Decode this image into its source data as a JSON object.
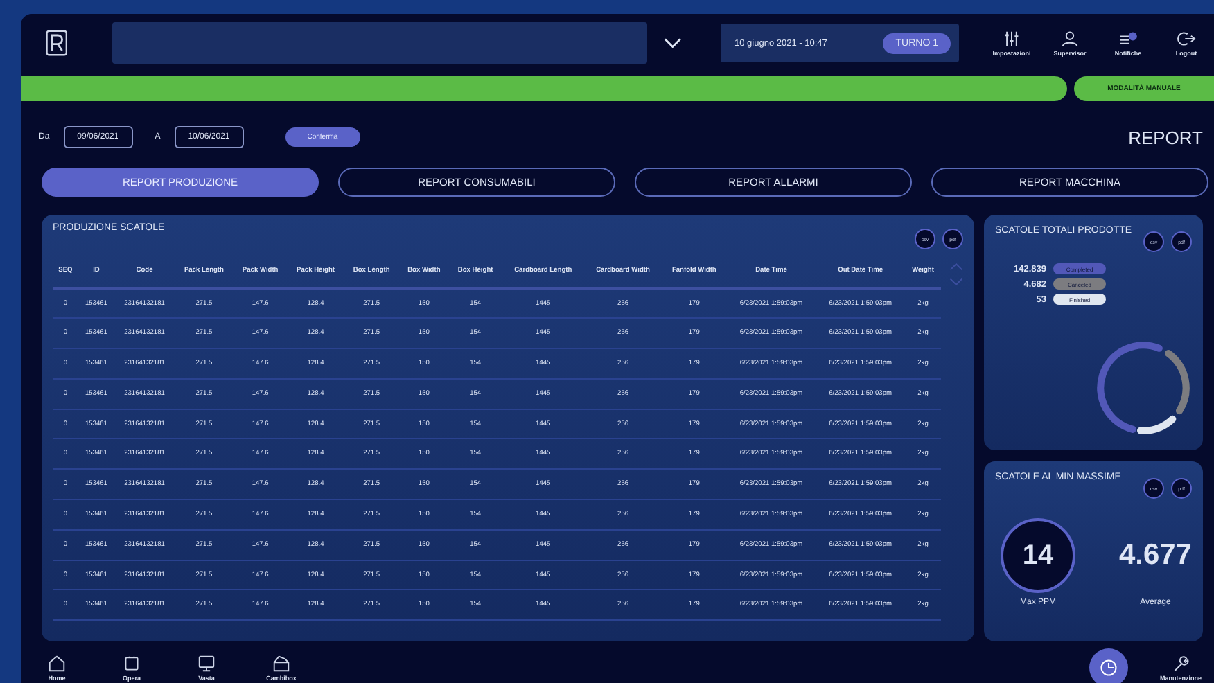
{
  "header": {
    "datetime": "10 giugno 2021 - 10:47",
    "shift": "TURNO 1",
    "nav": [
      {
        "kind": "settings",
        "label": "Impostazioni"
      },
      {
        "kind": "user",
        "label": "Supervisor"
      },
      {
        "kind": "bell",
        "label": "Notifiche"
      },
      {
        "kind": "logout",
        "label": "Logout"
      }
    ]
  },
  "mode": {
    "label": "MODALITÀ MANUALE"
  },
  "filter": {
    "from_label": "Da",
    "from": "09/06/2021",
    "to_label": "A",
    "to": "10/06/2021",
    "confirm": "Conferma"
  },
  "page_title": "REPORT",
  "tabs": [
    {
      "label": "REPORT PRODUZIONE",
      "selected": true
    },
    {
      "label": "REPORT CONSUMABILI",
      "selected": false
    },
    {
      "label": "REPORT ALLARMI",
      "selected": false
    },
    {
      "label": "REPORT MACCHINA",
      "selected": false
    }
  ],
  "table": {
    "title": "PRODUZIONE SCATOLE",
    "actions": [
      "csv",
      "pdf"
    ],
    "columns": [
      "SEQ",
      "ID",
      "Code",
      "Pack Length",
      "Pack Width",
      "Pack Height",
      "Box Length",
      "Box Width",
      "Box Height",
      "Cardboard Length",
      "Cardboard Width",
      "Fanfold Width",
      "Date Time",
      "Out Date Time",
      "Weight"
    ],
    "rows": [
      [
        "0",
        "153461",
        "23164132181",
        "271.5",
        "147.6",
        "128.4",
        "271.5",
        "150",
        "154",
        "1445",
        "256",
        "179",
        "6/23/2021 1:59:03pm",
        "6/23/2021 1:59:03pm",
        "2kg"
      ],
      [
        "0",
        "153461",
        "23164132181",
        "271.5",
        "147.6",
        "128.4",
        "271.5",
        "150",
        "154",
        "1445",
        "256",
        "179",
        "6/23/2021 1:59:03pm",
        "6/23/2021 1:59:03pm",
        "2kg"
      ],
      [
        "0",
        "153461",
        "23164132181",
        "271.5",
        "147.6",
        "128.4",
        "271.5",
        "150",
        "154",
        "1445",
        "256",
        "179",
        "6/23/2021 1:59:03pm",
        "6/23/2021 1:59:03pm",
        "2kg"
      ],
      [
        "0",
        "153461",
        "23164132181",
        "271.5",
        "147.6",
        "128.4",
        "271.5",
        "150",
        "154",
        "1445",
        "256",
        "179",
        "6/23/2021 1:59:03pm",
        "6/23/2021 1:59:03pm",
        "2kg"
      ],
      [
        "0",
        "153461",
        "23164132181",
        "271.5",
        "147.6",
        "128.4",
        "271.5",
        "150",
        "154",
        "1445",
        "256",
        "179",
        "6/23/2021 1:59:03pm",
        "6/23/2021 1:59:03pm",
        "2kg"
      ],
      [
        "0",
        "153461",
        "23164132181",
        "271.5",
        "147.6",
        "128.4",
        "271.5",
        "150",
        "154",
        "1445",
        "256",
        "179",
        "6/23/2021 1:59:03pm",
        "6/23/2021 1:59:03pm",
        "2kg"
      ],
      [
        "0",
        "153461",
        "23164132181",
        "271.5",
        "147.6",
        "128.4",
        "271.5",
        "150",
        "154",
        "1445",
        "256",
        "179",
        "6/23/2021 1:59:03pm",
        "6/23/2021 1:59:03pm",
        "2kg"
      ],
      [
        "0",
        "153461",
        "23164132181",
        "271.5",
        "147.6",
        "128.4",
        "271.5",
        "150",
        "154",
        "1445",
        "256",
        "179",
        "6/23/2021 1:59:03pm",
        "6/23/2021 1:59:03pm",
        "2kg"
      ],
      [
        "0",
        "153461",
        "23164132181",
        "271.5",
        "147.6",
        "128.4",
        "271.5",
        "150",
        "154",
        "1445",
        "256",
        "179",
        "6/23/2021 1:59:03pm",
        "6/23/2021 1:59:03pm",
        "2kg"
      ],
      [
        "0",
        "153461",
        "23164132181",
        "271.5",
        "147.6",
        "128.4",
        "271.5",
        "150",
        "154",
        "1445",
        "256",
        "179",
        "6/23/2021 1:59:03pm",
        "6/23/2021 1:59:03pm",
        "2kg"
      ],
      [
        "0",
        "153461",
        "23164132181",
        "271.5",
        "147.6",
        "128.4",
        "271.5",
        "150",
        "154",
        "1445",
        "256",
        "179",
        "6/23/2021 1:59:03pm",
        "6/23/2021 1:59:03pm",
        "2kg"
      ]
    ]
  },
  "totals": {
    "title": "SCATOLE TOTALI PRODOTTE",
    "actions": [
      "csv",
      "pdf"
    ],
    "legend": [
      {
        "value": "142.839",
        "label": "Completed",
        "color": "#5258b8"
      },
      {
        "value": "4.682",
        "label": "Canceled",
        "color": "#7c7c80"
      },
      {
        "value": "53",
        "label": "Finished",
        "color": "#dfe6f0"
      }
    ]
  },
  "per_minute": {
    "title": "SCATOLE AL MIN MASSIME",
    "actions": [
      "csv",
      "pdf"
    ],
    "max_value": "14",
    "max_label": "Max PPM",
    "avg_value": "4.677",
    "avg_label": "Average"
  },
  "bottom_nav": [
    {
      "kind": "home",
      "label": "Home"
    },
    {
      "kind": "square",
      "label": "Opera"
    },
    {
      "kind": "monitor",
      "label": "Vasta"
    },
    {
      "kind": "box",
      "label": "Cambibox"
    }
  ],
  "maintenance": {
    "label": "Manutenzione"
  }
}
